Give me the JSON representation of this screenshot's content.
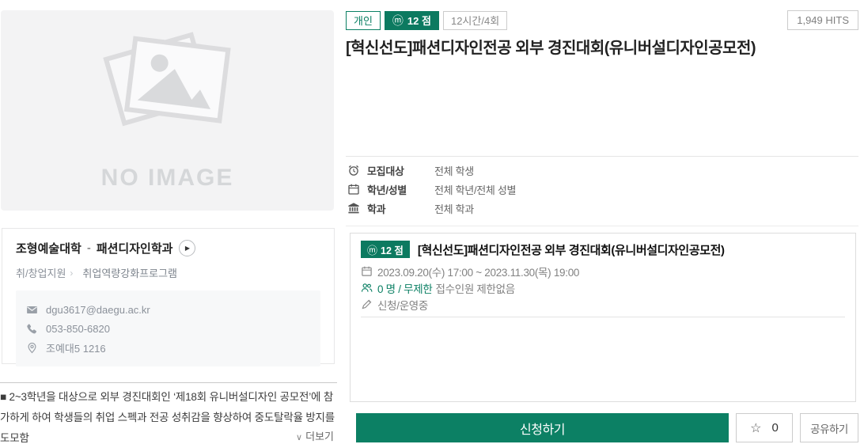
{
  "colors": {
    "primary": "#0c8064",
    "badge_solid": "#0c7a60"
  },
  "header": {
    "badge_personal": "개인",
    "badge_points_symbol": "ⓜ",
    "badge_points_label": "12 점",
    "badge_hours": "12시간/4회",
    "hits": "1,949 HITS",
    "title": "[혁신선도]패션디자인전공 외부 경진대회(유니버설디자인공모전)"
  },
  "details": {
    "rows": [
      {
        "icon": "alarm-clock-icon",
        "label": "모집대상",
        "value": "전체 학생"
      },
      {
        "icon": "calendar-icon",
        "label": "학년/성별",
        "value": "전체 학년/전체 성별"
      },
      {
        "icon": "bank-icon",
        "label": "학과",
        "value": "전체 학과"
      }
    ]
  },
  "left": {
    "no_image_label": "NO IMAGE",
    "college": "조형예술대학",
    "dash": "-",
    "department": "패션디자인학과",
    "play_symbol": "▶",
    "category": "취/창업지원",
    "breadcrumb_arrow": "›",
    "program_type": "취업역량강화프로그램",
    "contact": {
      "email": "dgu3617@daegu.ac.kr",
      "phone": "053-850-6820",
      "location": "조예대5 1216"
    },
    "description": "■ 2~3학년을 대상으로 외부 경진대회인 ‘제18회 유니버설디자인 공모전’에 참가하게 하여 학생들의 취업 스펙과 전공 성취감을 향상하여 중도탈락율 방지를 도모함",
    "more_chevron": "∨",
    "more_label": "더보기"
  },
  "program_card": {
    "badge_symbol": "ⓜ",
    "badge_label": "12 점",
    "title": "[혁신선도]패션디자인전공 외부 경진대회(유니버설디자인공모전)",
    "period": "2023.09.20(수) 17:00 ~ 2023.11.30(목) 19:00",
    "applicants_highlight": "0 명 / 무제한",
    "applicants_rest": "접수인원 제한없음",
    "status": "신청/운영중"
  },
  "footer": {
    "apply_label": "신청하기",
    "favorite_star": "☆",
    "favorite_count": "0",
    "share_label": "공유하기"
  }
}
